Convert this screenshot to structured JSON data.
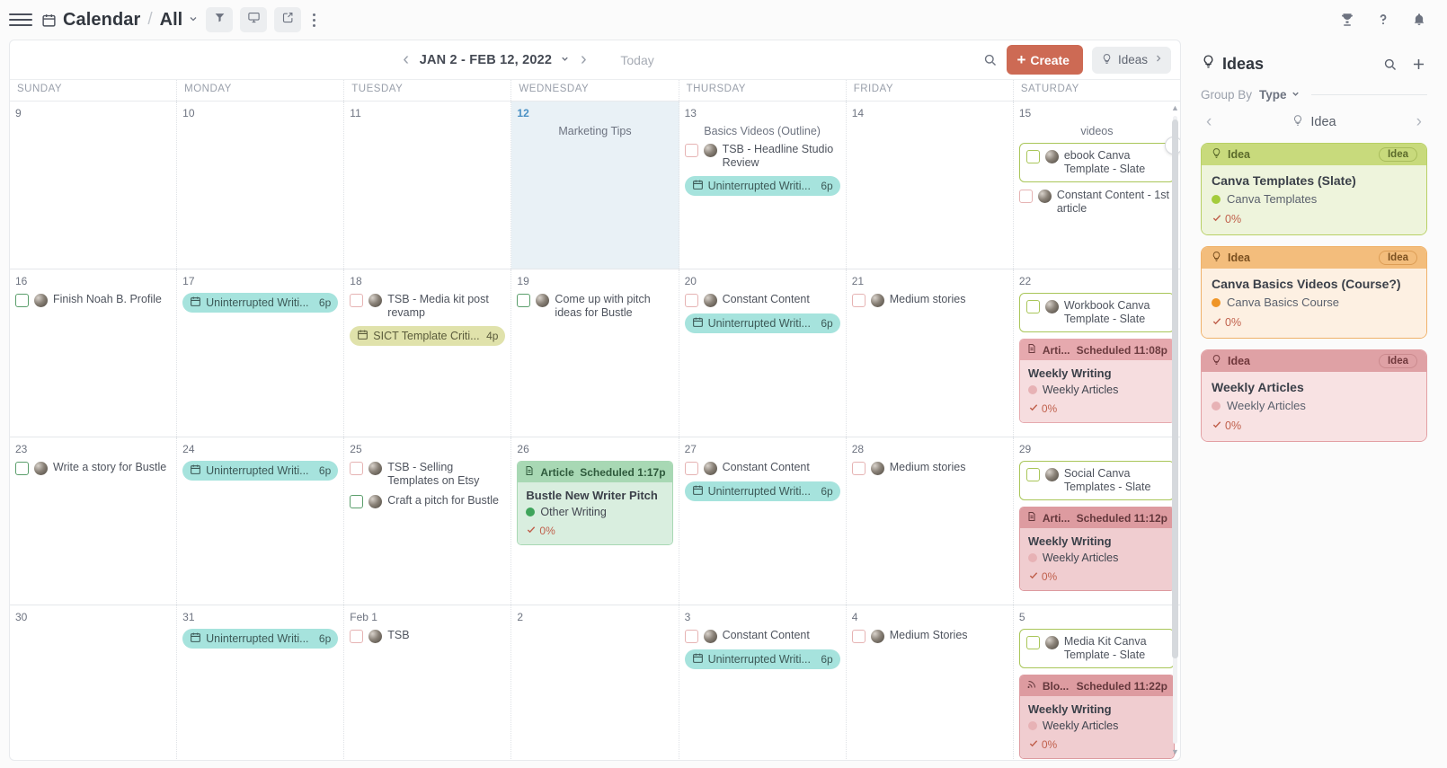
{
  "topbar": {
    "menu_icon": "hamburger-icon",
    "breadcrumb_icon": "calendar-icon",
    "title": "Calendar",
    "separator": "/",
    "subtitle": "All",
    "buttons": [
      {
        "name": "filter-icon",
        "active": true
      },
      {
        "name": "display-icon",
        "active": true
      },
      {
        "name": "share-icon",
        "active": true
      }
    ],
    "right_icons": [
      "trophy-icon",
      "help-icon",
      "bell-icon"
    ]
  },
  "calendar_toolbar": {
    "prev_label": "‹",
    "next_label": "›",
    "range": "JAN 2 - FEB 12, 2022",
    "today_label": "Today",
    "search_icon": "search-icon",
    "create_label": "Create",
    "create_color": "#cd6a54",
    "ideas_toggle_label": "Ideas"
  },
  "weekday_headers": [
    "SUNDAY",
    "MONDAY",
    "TUESDAY",
    "WEDNESDAY",
    "THURSDAY",
    "FRIDAY",
    "SATURDAY"
  ],
  "weeks": [
    {
      "days": [
        {
          "num": "9",
          "today": false,
          "items": []
        },
        {
          "num": "10",
          "today": false,
          "items": []
        },
        {
          "num": "11",
          "today": false,
          "items": []
        },
        {
          "num": "12",
          "today": true,
          "items": [
            {
              "kind": "label",
              "text": "Marketing Tips"
            }
          ]
        },
        {
          "num": "13",
          "today": false,
          "items": [
            {
              "kind": "label",
              "text": "Basics Videos (Outline)"
            },
            {
              "kind": "task",
              "text": "TSB - Headline Studio Review",
              "checkbox": "pink"
            },
            {
              "kind": "pill",
              "color": "teal",
              "text": "Uninterrupted Writi...",
              "time": "6p"
            }
          ]
        },
        {
          "num": "14",
          "today": false,
          "items": []
        },
        {
          "num": "15",
          "today": false,
          "items": [
            {
              "kind": "label",
              "text": "videos"
            },
            {
              "kind": "outlined",
              "text": "ebook Canva Template - Slate",
              "checkbox": "olive",
              "menu": true
            },
            {
              "kind": "task",
              "text": "Constant Content - 1st article",
              "checkbox": "pink"
            }
          ]
        }
      ]
    },
    {
      "days": [
        {
          "num": "16",
          "today": false,
          "items": [
            {
              "kind": "task",
              "text": "Finish Noah B. Profile",
              "checkbox": "green"
            }
          ]
        },
        {
          "num": "17",
          "today": false,
          "items": [
            {
              "kind": "pill",
              "color": "teal",
              "text": "Uninterrupted Writi...",
              "time": "6p"
            }
          ]
        },
        {
          "num": "18",
          "today": false,
          "items": [
            {
              "kind": "task",
              "text": "TSB - Media kit post revamp",
              "checkbox": "pink"
            },
            {
              "kind": "pill",
              "color": "olive",
              "text": "SICT Template Criti...",
              "time": "4p"
            }
          ]
        },
        {
          "num": "19",
          "today": false,
          "items": [
            {
              "kind": "task",
              "text": "Come up with pitch ideas for Bustle",
              "checkbox": "green"
            }
          ]
        },
        {
          "num": "20",
          "today": false,
          "items": [
            {
              "kind": "task",
              "text": "Constant Content",
              "checkbox": "pink"
            },
            {
              "kind": "pill",
              "color": "teal",
              "text": "Uninterrupted Writi...",
              "time": "6p"
            }
          ]
        },
        {
          "num": "21",
          "today": false,
          "items": [
            {
              "kind": "task",
              "text": "Medium stories",
              "checkbox": "pink"
            }
          ]
        },
        {
          "num": "22",
          "today": false,
          "items": [
            {
              "kind": "outlined",
              "text": "Workbook Canva Template - Slate",
              "checkbox": "olive",
              "menu": false
            },
            {
              "kind": "doc",
              "style": "dc-pink",
              "type_icon": "article-icon",
              "type": "Arti...",
              "scheduled": "Scheduled 11:08p",
              "title": "Weekly Writing",
              "category": "Weekly Articles",
              "cat_color": "#e7b2b5",
              "pct": "0%"
            }
          ]
        }
      ]
    },
    {
      "days": [
        {
          "num": "23",
          "today": false,
          "items": [
            {
              "kind": "task",
              "text": "Write a story for Bustle",
              "checkbox": "green"
            }
          ]
        },
        {
          "num": "24",
          "today": false,
          "items": [
            {
              "kind": "pill",
              "color": "teal",
              "text": "Uninterrupted Writi...",
              "time": "6p"
            }
          ]
        },
        {
          "num": "25",
          "today": false,
          "items": [
            {
              "kind": "task",
              "text": "TSB - Selling Templates on Etsy",
              "checkbox": "pink"
            },
            {
              "kind": "task",
              "text": "Craft a pitch for Bustle",
              "checkbox": "green"
            }
          ]
        },
        {
          "num": "26",
          "today": false,
          "items": [
            {
              "kind": "doc",
              "style": "dc-green",
              "type_icon": "article-icon",
              "type": "Article",
              "scheduled": "Scheduled 1:17p",
              "title": "Bustle New Writer Pitch",
              "category": "Other Writing",
              "cat_color": "#3fa45b",
              "pct": "0%"
            }
          ]
        },
        {
          "num": "27",
          "today": false,
          "items": [
            {
              "kind": "task",
              "text": "Constant Content",
              "checkbox": "pink"
            },
            {
              "kind": "pill",
              "color": "teal",
              "text": "Uninterrupted Writi...",
              "time": "6p"
            }
          ]
        },
        {
          "num": "28",
          "today": false,
          "items": [
            {
              "kind": "task",
              "text": "Medium stories",
              "checkbox": "pink"
            }
          ]
        },
        {
          "num": "29",
          "today": false,
          "items": [
            {
              "kind": "outlined",
              "text": "Social Canva Templates - Slate",
              "checkbox": "olive",
              "menu": false
            },
            {
              "kind": "doc",
              "style": "dc-pink2",
              "type_icon": "article-icon",
              "type": "Arti...",
              "scheduled": "Scheduled 11:12p",
              "title": "Weekly Writing",
              "category": "Weekly Articles",
              "cat_color": "#e7b2b5",
              "pct": "0%"
            }
          ]
        }
      ]
    },
    {
      "days": [
        {
          "num": "30",
          "today": false,
          "items": []
        },
        {
          "num": "31",
          "today": false,
          "items": [
            {
              "kind": "pill",
              "color": "teal",
              "text": "Uninterrupted Writi...",
              "time": "6p"
            }
          ]
        },
        {
          "num": "Feb 1",
          "today": false,
          "items": [
            {
              "kind": "task",
              "text": "TSB",
              "checkbox": "pink"
            }
          ]
        },
        {
          "num": "2",
          "today": false,
          "items": []
        },
        {
          "num": "3",
          "today": false,
          "items": [
            {
              "kind": "task",
              "text": "Constant Content",
              "checkbox": "pink"
            },
            {
              "kind": "pill",
              "color": "teal",
              "text": "Uninterrupted Writi...",
              "time": "6p"
            }
          ]
        },
        {
          "num": "4",
          "today": false,
          "items": [
            {
              "kind": "task",
              "text": "Medium Stories",
              "checkbox": "pink"
            }
          ]
        },
        {
          "num": "5",
          "today": false,
          "items": [
            {
              "kind": "outlined",
              "text": "Media Kit Canva Template - Slate",
              "checkbox": "olive",
              "menu": false
            },
            {
              "kind": "doc",
              "style": "dc-pink2",
              "type_icon": "blog-icon",
              "type": "Blo...",
              "scheduled": "Scheduled 11:22p",
              "title": "Weekly Writing",
              "category": "Weekly Articles",
              "cat_color": "#e7b2b5",
              "pct": "0%"
            }
          ]
        }
      ]
    }
  ],
  "ideas_panel": {
    "icon": "lightbulb-icon",
    "title": "Ideas",
    "search_icon": "search-icon",
    "add_icon": "plus-icon",
    "group_by_label": "Group By",
    "group_by_value": "Type",
    "group_prev": "‹",
    "group_next": "›",
    "group_name": "Idea",
    "cards": [
      {
        "style": "ic-green",
        "type": "Idea",
        "badge": "Idea",
        "title": "Canva Templates (Slate)",
        "category": "Canva Templates",
        "cat_color": "#a4cc3c",
        "pct": "0%"
      },
      {
        "style": "ic-orange",
        "type": "Idea",
        "badge": "Idea",
        "title": "Canva Basics Videos (Course?)",
        "category": "Canva Basics Course",
        "cat_color": "#ef9527",
        "pct": "0%"
      },
      {
        "style": "ic-red",
        "type": "Idea",
        "badge": "Idea",
        "title": "Weekly Articles",
        "category": "Weekly Articles",
        "cat_color": "#e7b2b5",
        "pct": "0%"
      }
    ]
  }
}
